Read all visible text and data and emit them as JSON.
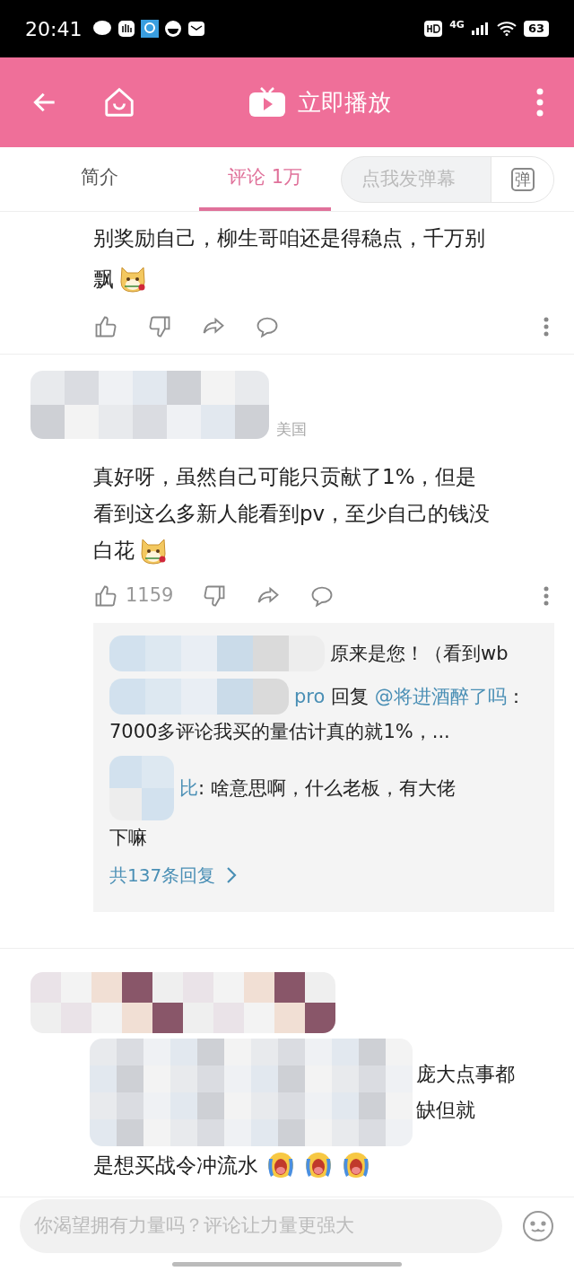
{
  "status_bar": {
    "time": "20:41",
    "network": "4G",
    "battery": "63"
  },
  "header": {
    "title": "立即播放"
  },
  "tabs": [
    {
      "label": "简介",
      "selected": false
    },
    {
      "label": "评论 1万",
      "selected": true
    }
  ],
  "danmaku": {
    "placeholder": "点我发弹幕",
    "button": "弹"
  },
  "comments": [
    {
      "kind": "cut",
      "lines": [
        "别奖励自己，柳生哥咱还是得稳点，千万别",
        "飘"
      ],
      "emojis": [
        {
          "kind": "dog"
        }
      ]
    },
    {
      "kind": "full",
      "location": "美国",
      "lines": [
        "真好呀，虽然自己可能只贡献了1%，但是",
        "看到这么多新人能看到pv，至少自己的钱没",
        "白花"
      ],
      "emojis": [
        {
          "kind": "dog"
        }
      ],
      "likes": "1159",
      "replies": {
        "items": [
          {
            "visible": [
              {
                "t": "原来是您！（看到wb",
                "link": false
              }
            ]
          },
          {
            "visible": [
              {
                "t": "pro",
                "link": true
              },
              {
                "t": " 回复 ",
                "link": false
              },
              {
                "t": "@将进酒醉了吗",
                "link": true
              },
              {
                "t": "：",
                "link": false
              }
            ],
            "second": "7000多评论我买的量估计真的就1%，..."
          },
          {
            "visible": [
              {
                "t": "比",
                "link": true
              },
              {
                "t": ": 啥意思啊，什么老板，有大佬",
                "link": false
              }
            ],
            "second": "下嘛"
          }
        ],
        "more": "共137条回复"
      }
    },
    {
      "kind": "covered",
      "fragments": [
        "庞大点事都",
        "缺但就"
      ],
      "lines": [
        "是想买战令冲流水"
      ],
      "emojis": [
        {
          "kind": "crying"
        },
        {
          "kind": "crying"
        },
        {
          "kind": "crying"
        }
      ]
    }
  ],
  "composer": {
    "placeholder": "你渴望拥有力量吗？评论让力量更强大"
  }
}
